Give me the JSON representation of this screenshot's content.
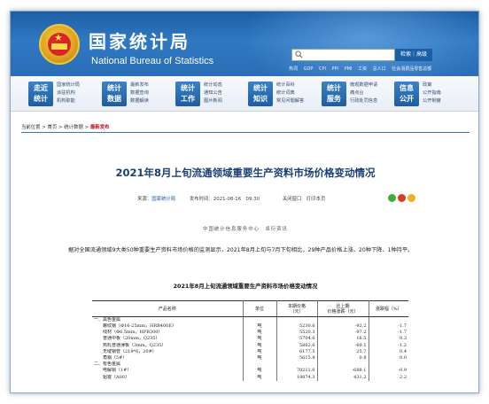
{
  "header": {
    "cn_title": "国家统计局",
    "en_title": "National Bureau of Statistics",
    "search_button": "检索｜高级",
    "hot_links": [
      "热词",
      "GDP",
      "CPI",
      "PPI",
      "PMI",
      "工资",
      "总人口",
      "社会消费品零售总额"
    ]
  },
  "nav": [
    {
      "badge": [
        "走近",
        "统计"
      ],
      "links": [
        "国家统计局",
        "派驻机构",
        "机构职能"
      ]
    },
    {
      "badge": [
        "统计",
        "数据"
      ],
      "links": [
        "最新发布",
        "数据查询",
        "数据解读"
      ]
    },
    {
      "badge": [
        "统计",
        "工作"
      ],
      "links": [
        "统计动态",
        "通知公告",
        "图片新闻"
      ]
    },
    {
      "badge": [
        "统计",
        "知识"
      ],
      "links": [
        "统计百科",
        "统计词典",
        "常见问题解答"
      ]
    },
    {
      "badge": [
        "统计",
        "服务"
      ],
      "links": [
        "微观数据申请",
        "痛点台",
        "行政处罚信息"
      ]
    },
    {
      "badge": [
        "信息",
        "公开"
      ],
      "links": [
        "政策",
        "公开指南",
        "公开制度"
      ]
    }
  ],
  "breadcrumb": {
    "label": "当前位置",
    "items": [
      "首页",
      "统计数据",
      "最新发布"
    ]
  },
  "article": {
    "title": "2021年8月上旬流通领域重要生产资料市场价格变动情况",
    "source_label": "来源：",
    "source": "国家统计局",
    "time": "发布时间：2021-08-16　09:30",
    "actions": "关闭窗口　打印本页",
    "byline": "中国统计信息服务中心　卓衍资讯",
    "paragraph": "据对全国流通领域9大类50种重要生产资料市场价格的监测显示，2021年8月上旬与7月下旬相比，29种产品价格上涨、20种下降、1种持平。",
    "table_title": "2021年8月上旬流通领域重要生产资料市场价格变动情况"
  },
  "table": {
    "headers": [
      "产品名称",
      "单位",
      "本期价格\n（元）",
      "比上期\n价格涨跌（元）",
      "涨跌幅（%）"
    ],
    "rows": [
      {
        "name": "一、黑色金属",
        "unit": "",
        "price": "",
        "change": "",
        "pct": "",
        "section": true
      },
      {
        "name": "螺纹钢（Φ16-25mm，HRB400E）",
        "unit": "吨",
        "price": "5230.6",
        "change": "-92.2",
        "pct": "-1.7"
      },
      {
        "name": "线材（Φ6.5mm，HPB300）",
        "unit": "吨",
        "price": "5520.3",
        "change": "-97.2",
        "pct": "-1.7"
      },
      {
        "name": "普通中板（20mm，Q235）",
        "unit": "吨",
        "price": "5704.6",
        "change": "16.5",
        "pct": "0.3"
      },
      {
        "name": "热轧普通薄板（3mm，Q235）",
        "unit": "吨",
        "price": "5862.6",
        "change": "-69.1",
        "pct": "-1.2"
      },
      {
        "name": "无缝钢管（219*6，20#）",
        "unit": "吨",
        "price": "6177.5",
        "change": "25.7",
        "pct": "0.4"
      },
      {
        "name": "角钢（5#）",
        "unit": "吨",
        "price": "5615.8",
        "change": "0.8",
        "pct": "0.0"
      },
      {
        "name": "二、有色金属",
        "unit": "",
        "price": "",
        "change": "",
        "pct": "",
        "section": true
      },
      {
        "name": "电解铜（1#）",
        "unit": "吨",
        "price": "70211.0",
        "change": "-688.1",
        "pct": "-0.9"
      },
      {
        "name": "铝锭（A00）",
        "unit": "吨",
        "price": "19874.3",
        "change": "431.2",
        "pct": "2.2"
      }
    ]
  },
  "colors": {
    "header_blue": "#1c5fa6",
    "title_blue": "#1a3f73",
    "highlight_red": "#c0161b"
  }
}
